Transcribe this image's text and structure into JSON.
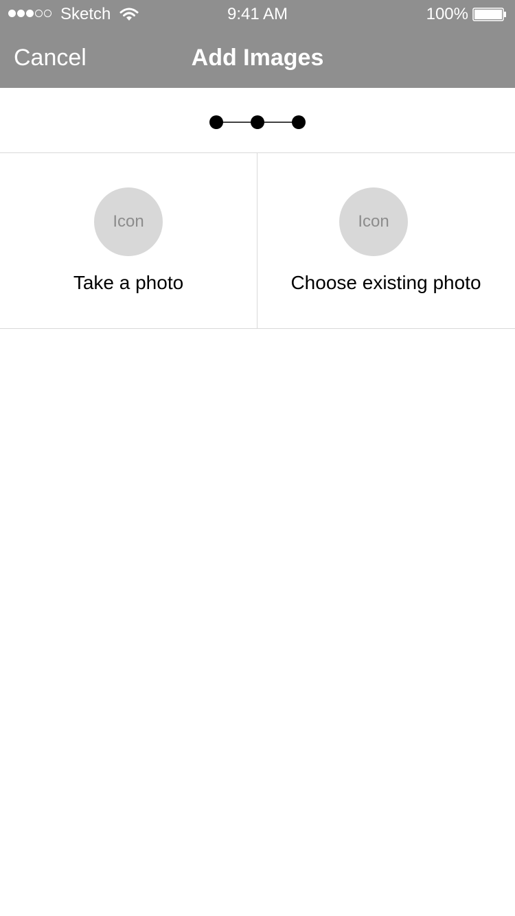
{
  "status_bar": {
    "signal": {
      "filled_dots": 3,
      "total_dots": 5
    },
    "carrier": "Sketch",
    "wifi_icon": "wifi-icon",
    "time": "9:41 AM",
    "battery_percent": "100%",
    "battery_icon": "battery-icon",
    "battery_level": 1.0
  },
  "nav": {
    "cancel_label": "Cancel",
    "title": "Add Images"
  },
  "progress": {
    "steps": 3,
    "icon": "step-progress-indicator"
  },
  "options": [
    {
      "icon_label": "Icon",
      "label": "Take a photo"
    },
    {
      "icon_label": "Icon",
      "label": "Choose existing photo"
    }
  ],
  "colors": {
    "nav_background": "#8f8f8f",
    "nav_text": "#ffffff",
    "icon_placeholder": "#d8d8d8",
    "icon_text": "#8c8c8c",
    "divider": "#d9d9d9"
  }
}
